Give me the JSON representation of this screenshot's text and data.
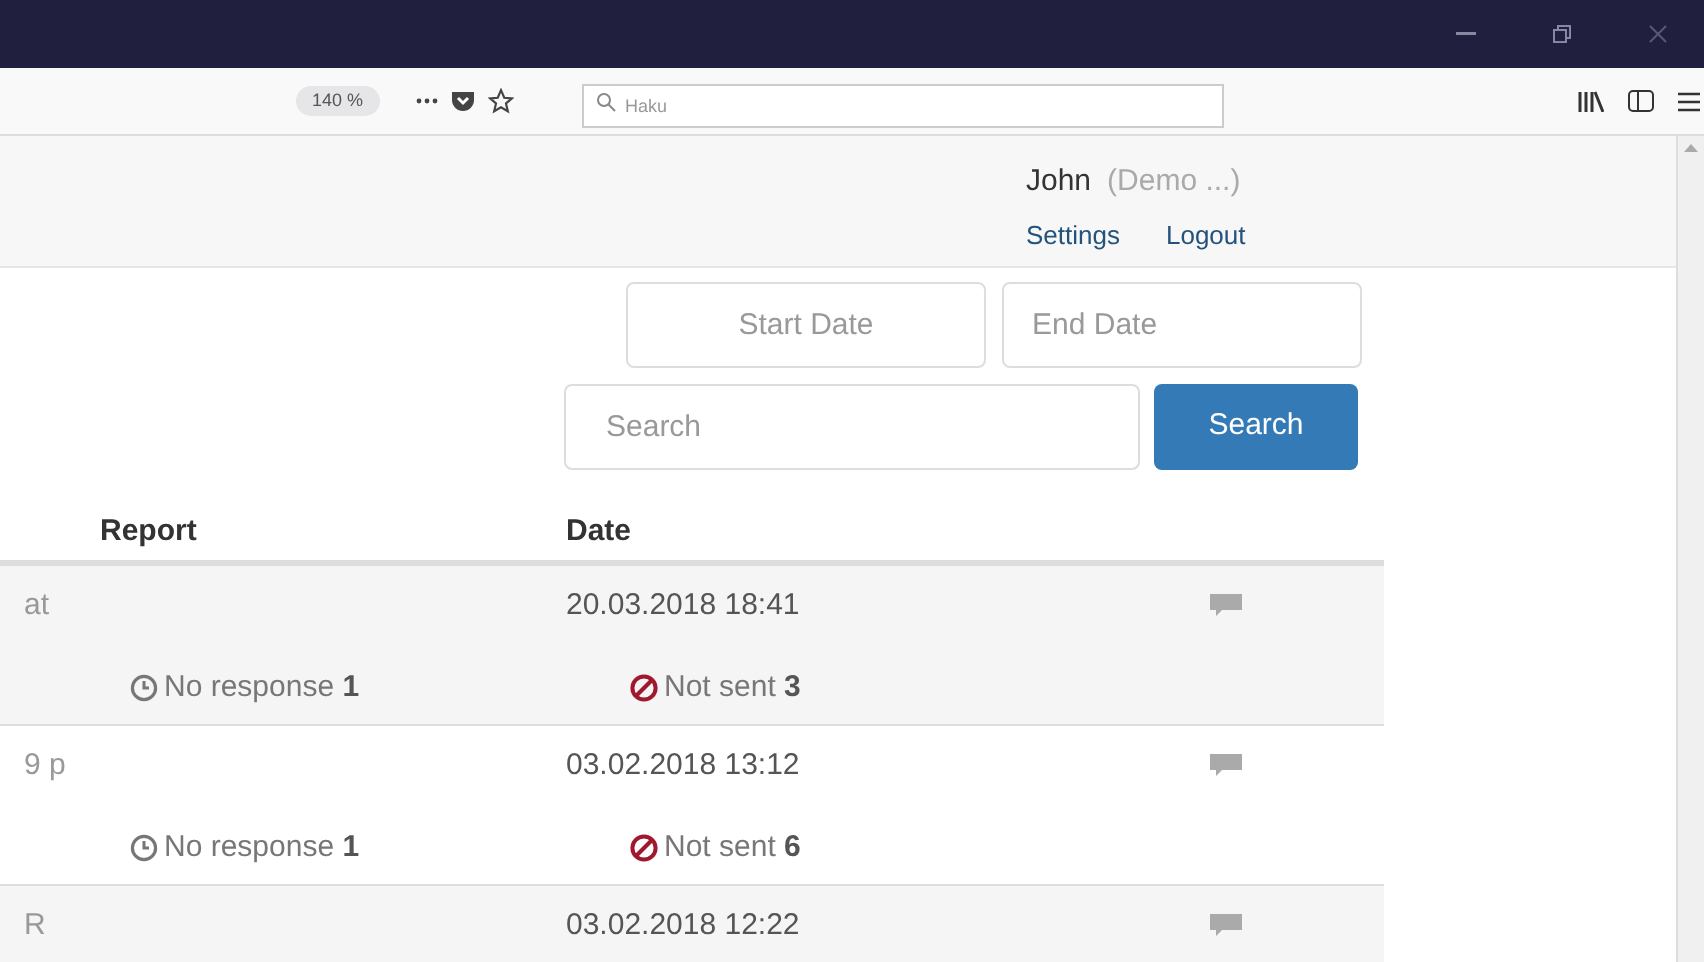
{
  "browser": {
    "zoom": "140 %",
    "search_placeholder": "Haku"
  },
  "user": {
    "name": "John",
    "org": "(Demo ...)",
    "links": [
      "Settings",
      "Logout"
    ]
  },
  "filters": {
    "start_placeholder": "Start Date",
    "end_placeholder": "End Date",
    "search_placeholder": "Search",
    "search_button": "Search"
  },
  "table": {
    "columns": [
      "Report",
      "Date"
    ],
    "rows": [
      {
        "report": "at",
        "date": "20.03.2018 18:41",
        "no_response": "No response",
        "no_response_count": "1",
        "not_sent": "Not sent",
        "not_sent_count": "3"
      },
      {
        "report": "9 p",
        "date": "03.02.2018 13:12",
        "no_response": "No response",
        "no_response_count": "1",
        "not_sent": "Not sent",
        "not_sent_count": "6"
      },
      {
        "report": "R",
        "date": "03.02.2018 12:22"
      }
    ]
  }
}
